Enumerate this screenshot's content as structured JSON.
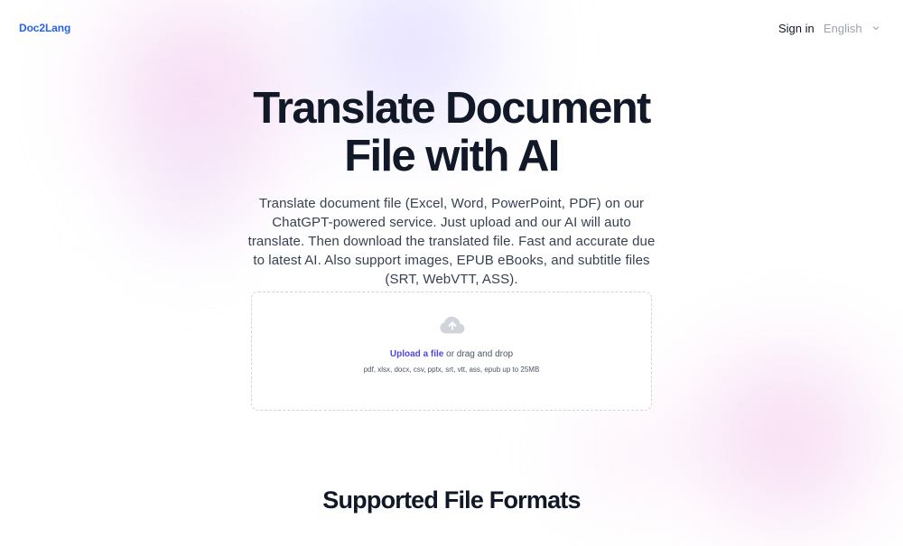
{
  "header": {
    "logo_text": "Doc2Lang",
    "signin_label": "Sign in",
    "language_selected": "English"
  },
  "hero": {
    "title": "Translate Document File with AI",
    "description": "Translate document file (Excel, Word, PowerPoint, PDF) on our ChatGPT-powered service. Just upload and our AI will auto translate. Then download the translated file. Fast and accurate due to latest AI. Also support images, EPUB eBooks, and subtitle files (SRT, WebVTT, ASS)."
  },
  "upload": {
    "link_text": "Upload a file",
    "drag_text": " or drag and drop",
    "formats_text": "pdf, xlsx, docx, csv, pptx, srt, vtt, ass, epub up to 25MB",
    "icon": "cloud-upload-icon"
  },
  "section": {
    "supported_formats_title": "Supported File Formats"
  },
  "colors": {
    "accent_blue": "#2563eb",
    "upload_link": "#4f46e5",
    "text_dark": "#111827",
    "text_body": "#374151",
    "text_muted": "#9ca3af",
    "border_dashed": "#cbd5e1"
  },
  "icons": {
    "language_chevron": "chevron-down-icon",
    "upload_icon": "cloud-upload-icon"
  }
}
